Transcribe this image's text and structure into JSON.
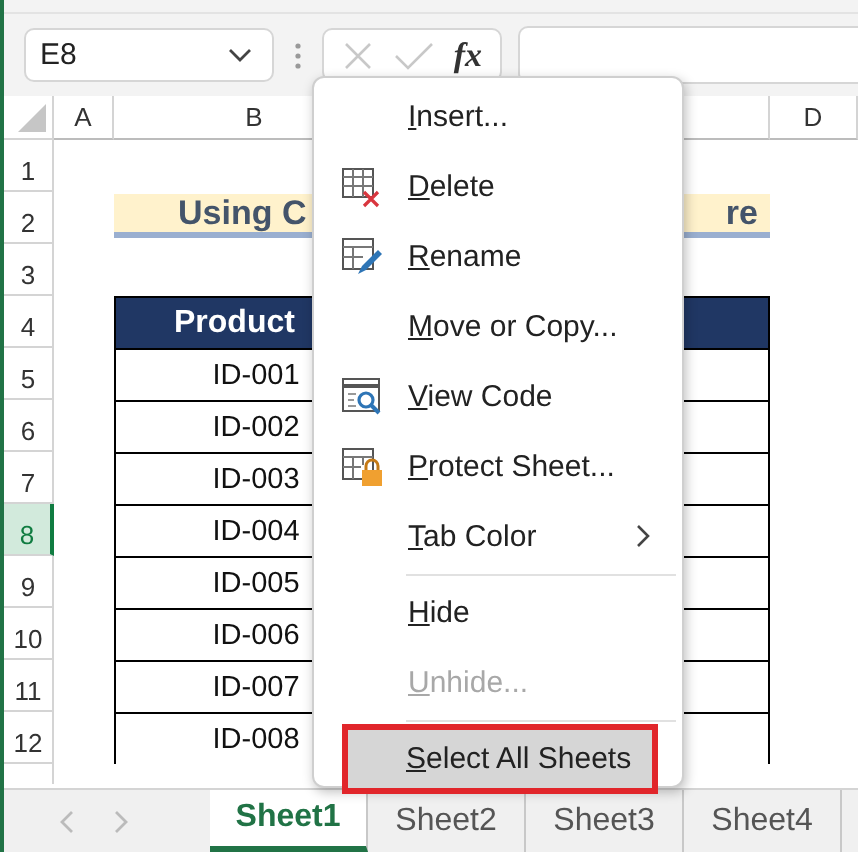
{
  "formula_bar": {
    "name_box": "E8",
    "function_label": "fx"
  },
  "columns": [
    {
      "kind": "label",
      "label": "A"
    },
    {
      "kind": "label",
      "label": "B"
    },
    {
      "kind": "covered"
    },
    {
      "kind": "label",
      "label": "D"
    }
  ],
  "rows": [
    {
      "label": "1",
      "selected": false,
      "kind": "blank"
    },
    {
      "label": "2",
      "selected": false,
      "kind": "title",
      "text_left": "Using C",
      "text_right": "re"
    },
    {
      "label": "3",
      "selected": false,
      "kind": "blank"
    },
    {
      "label": "4",
      "selected": false,
      "kind": "header",
      "text": "Product"
    },
    {
      "label": "5",
      "selected": false,
      "kind": "data",
      "text": "ID-001"
    },
    {
      "label": "6",
      "selected": false,
      "kind": "data",
      "text": "ID-002"
    },
    {
      "label": "7",
      "selected": false,
      "kind": "data",
      "text": "ID-003"
    },
    {
      "label": "8",
      "selected": true,
      "kind": "data",
      "text": "ID-004"
    },
    {
      "label": "9",
      "selected": false,
      "kind": "data",
      "text": "ID-005"
    },
    {
      "label": "10",
      "selected": false,
      "kind": "data",
      "text": "ID-006"
    },
    {
      "label": "11",
      "selected": false,
      "kind": "data",
      "text": "ID-007"
    },
    {
      "label": "12",
      "selected": false,
      "kind": "data",
      "text": "ID-008"
    }
  ],
  "context_menu": {
    "groups": [
      [
        {
          "label": "Insert...",
          "kind": "item",
          "selected": false,
          "disabled": false
        },
        {
          "label": "Delete",
          "kind": "item",
          "selected": false,
          "disabled": false
        },
        {
          "label": "Rename",
          "kind": "item",
          "selected": false,
          "disabled": false
        },
        {
          "label": "Move or Copy...",
          "kind": "item",
          "selected": false,
          "disabled": false
        },
        {
          "label": "View Code",
          "kind": "item",
          "selected": false,
          "disabled": false
        },
        {
          "label": "Protect Sheet...",
          "kind": "item",
          "selected": false,
          "disabled": false
        },
        {
          "label": "Tab Color",
          "kind": "submenu",
          "selected": false,
          "disabled": false
        }
      ],
      [
        {
          "label": "Hide",
          "kind": "item",
          "selected": false,
          "disabled": false
        },
        {
          "label": "Unhide...",
          "kind": "item",
          "selected": false,
          "disabled": true
        }
      ],
      [
        {
          "label": "Select All Sheets",
          "kind": "item",
          "selected": true,
          "disabled": false
        }
      ]
    ]
  },
  "sheet_tabs": [
    {
      "label": "Sheet1",
      "selected": true
    },
    {
      "label": "Sheet2",
      "selected": false
    },
    {
      "label": "Sheet3",
      "selected": false
    },
    {
      "label": "Sheet4",
      "selected": false
    }
  ]
}
